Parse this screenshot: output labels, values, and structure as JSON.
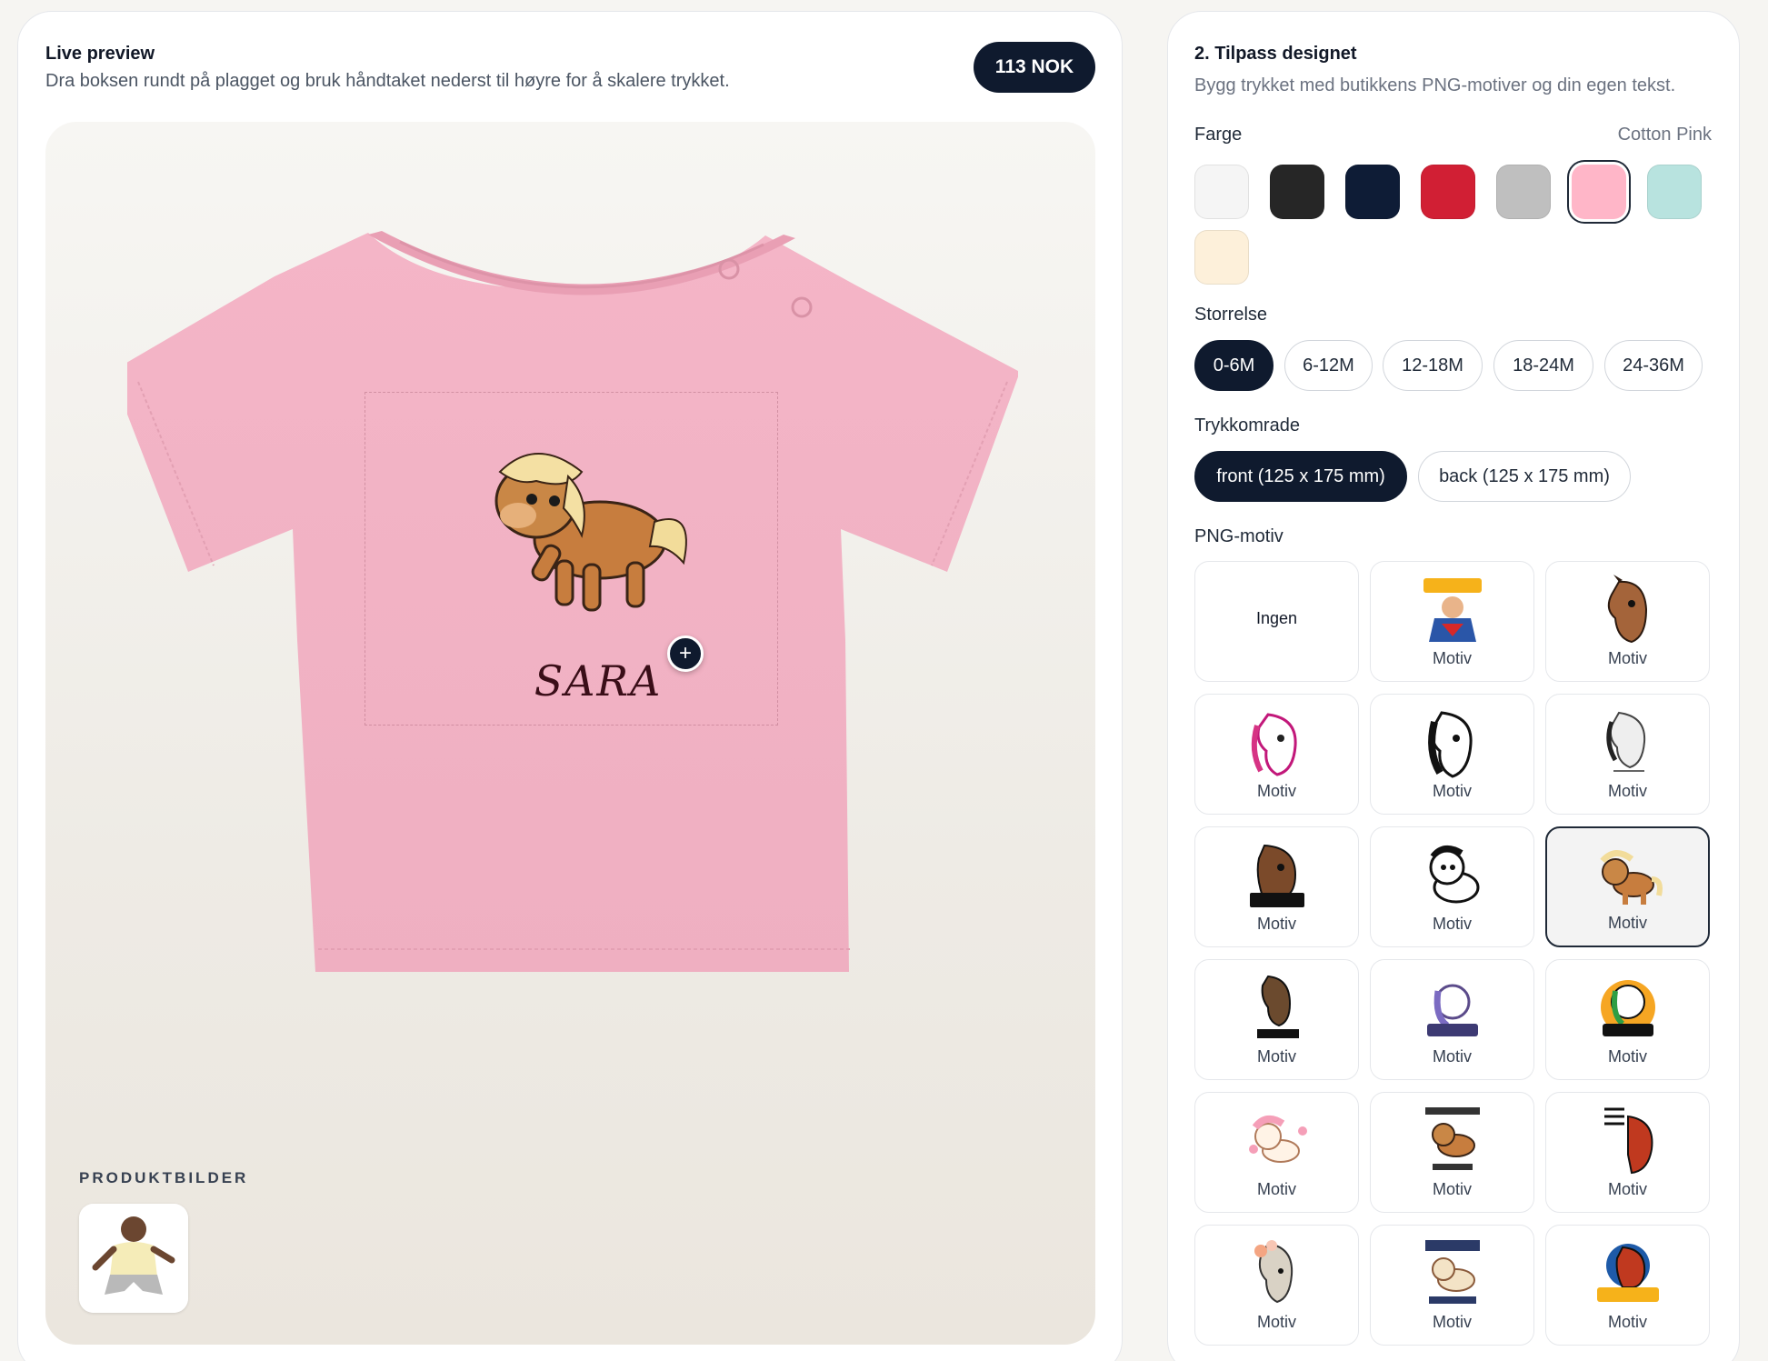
{
  "preview": {
    "title": "Live preview",
    "subtitle": "Dra boksen rundt på plagget og bruk håndtaket nederst til høyre for å skalere trykket.",
    "price": "113 NOK",
    "print_text": "SARA",
    "handle_symbol": "+",
    "product_images_label": "PRODUKTBILDER"
  },
  "customize": {
    "title": "2. Tilpass designet",
    "subtitle": "Bygg trykket med butikkens PNG-motiver og din egen tekst.",
    "color": {
      "label": "Farge",
      "selected_name": "Cotton Pink",
      "swatches": [
        {
          "name": "white",
          "hex": "#f5f5f5"
        },
        {
          "name": "black",
          "hex": "#262626"
        },
        {
          "name": "navy",
          "hex": "#0e1c36"
        },
        {
          "name": "red",
          "hex": "#d11f34"
        },
        {
          "name": "grey",
          "hex": "#bfbfbf"
        },
        {
          "name": "cotton-pink",
          "hex": "#ffb6c8",
          "selected": true
        },
        {
          "name": "mint",
          "hex": "#b8e3df"
        },
        {
          "name": "cream",
          "hex": "#fdf0da"
        }
      ]
    },
    "size": {
      "label": "Storrelse",
      "options": [
        "0-6M",
        "6-12M",
        "12-18M",
        "18-24M",
        "24-36M"
      ],
      "selected": "0-6M"
    },
    "print_area": {
      "label": "Trykkomrade",
      "options": [
        "front (125 x 175 mm)",
        "back (125 x 175 mm)"
      ],
      "selected": "front (125 x 175 mm)"
    },
    "motifs": {
      "label": "PNG-motiv",
      "none_label": "Ingen",
      "item_label": "Motiv",
      "items": [
        {
          "icon": "none"
        },
        {
          "icon": "ponnipappa-superhero-icon"
        },
        {
          "icon": "horse-head-brown-icon"
        },
        {
          "icon": "horse-head-pink-icon"
        },
        {
          "icon": "horse-head-black-white-icon"
        },
        {
          "icon": "horse-head-sketch-icon"
        },
        {
          "icon": "livet-er-en-fest-horse-icon"
        },
        {
          "icon": "cartoon-pony-bw-icon"
        },
        {
          "icon": "brown-pony-icon",
          "selected": true
        },
        {
          "icon": "stallfolk-horse-icon"
        },
        {
          "icon": "sma-ryttere-unicorn-icon"
        },
        {
          "icon": "sma-ryttere-store-drommer-icon"
        },
        {
          "icon": "pink-pony-flowers-icon"
        },
        {
          "icon": "jeg-har-ikke-penger-pony-icon"
        },
        {
          "icon": "jeg-har-ikke-penger-horse-icon"
        },
        {
          "icon": "horse-flowers-icon"
        },
        {
          "icon": "mamma-trenger-ikke-penger-icon"
        },
        {
          "icon": "ponnipappa-horse-icon"
        }
      ]
    }
  }
}
